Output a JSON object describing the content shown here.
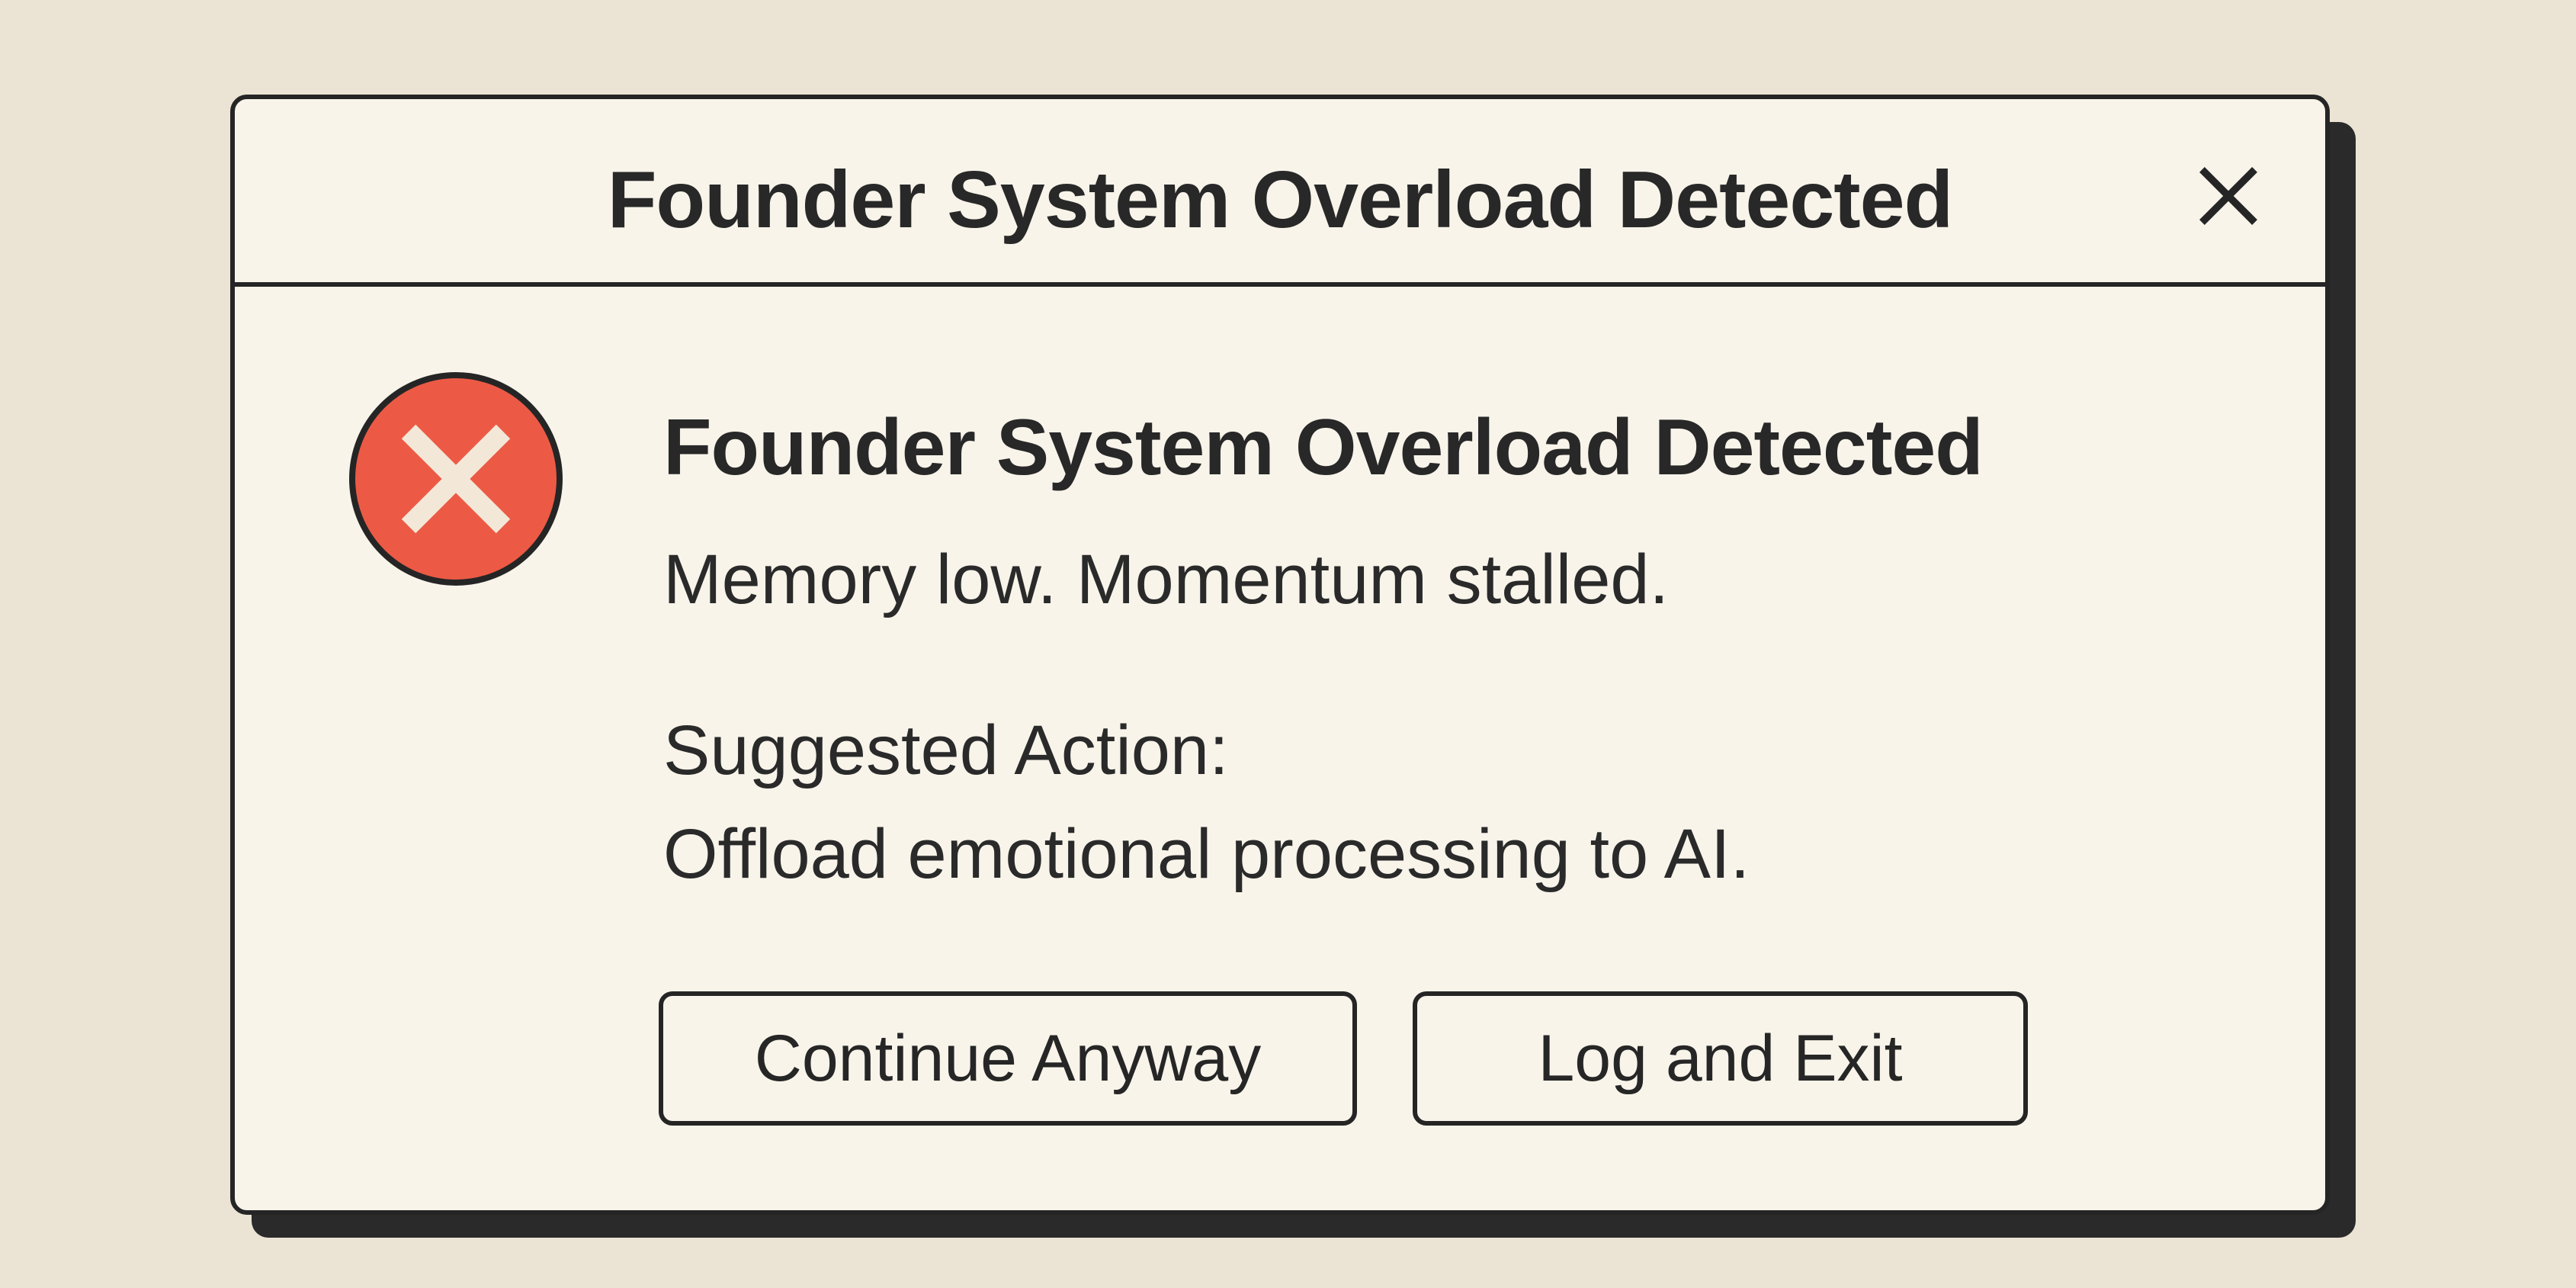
{
  "dialog": {
    "title": "Founder System Overload Detected",
    "close_icon": "close-icon",
    "error_icon": "error-icon",
    "message_title": "Founder System Overload Detected",
    "message_body": "Memory low. Momentum stalled.",
    "action_label": "Suggested Action:",
    "action_text": "Offload emotional processing to AI.",
    "buttons": {
      "continue_label": "Continue Anyway",
      "exit_label": "Log and Exit"
    }
  },
  "colors": {
    "background": "#ebe4d5",
    "dialog_fill": "#f8f4ea",
    "border": "#252525",
    "error_red": "#ec5a45"
  }
}
